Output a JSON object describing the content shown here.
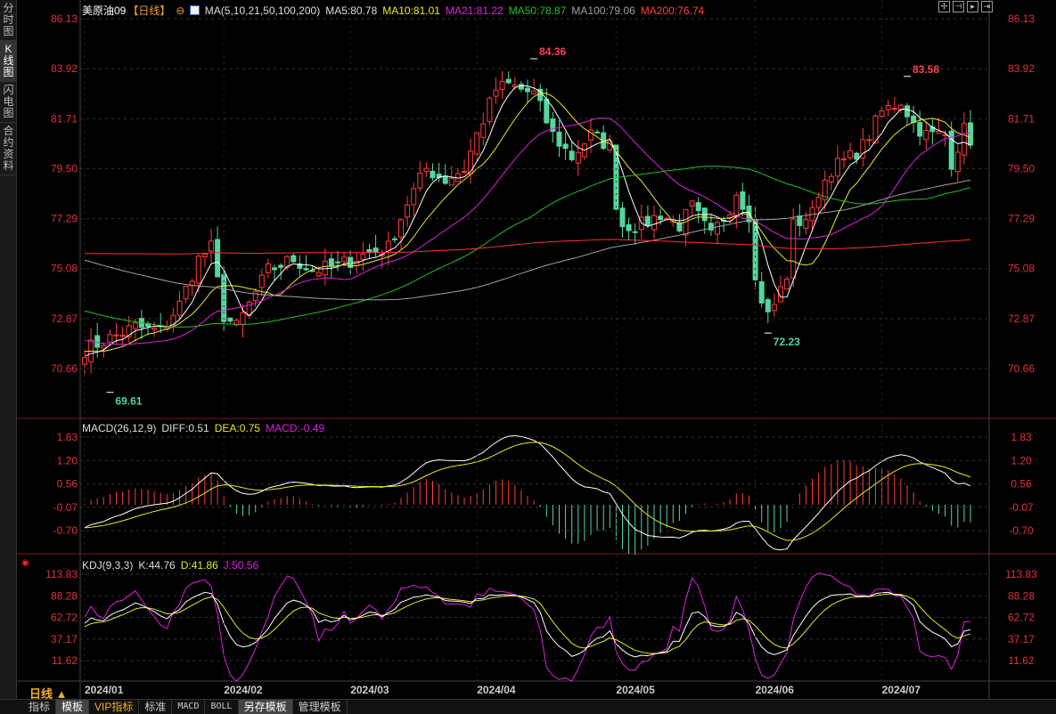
{
  "sidebar": {
    "tabs": [
      {
        "label": "分时图"
      },
      {
        "label": "K线图"
      },
      {
        "label": "闪电图"
      },
      {
        "label": "合约资料"
      }
    ]
  },
  "header": {
    "symbol": "美原油09",
    "period": "【日线】",
    "ma_label": "MA(5,10,21,50,100,200)",
    "ma5": "MA5:80.78",
    "ma10": "MA10:81.01",
    "ma21": "MA21:81.22",
    "ma50": "MA50:78.87",
    "ma100": "MA100:79.06",
    "ma200": "MA200:76.74"
  },
  "macd_legend": {
    "name": "MACD(26,12,9)",
    "diff": "DIFF:0.51",
    "dea": "DEA:0.75",
    "macd": "MACD:-0.49"
  },
  "kdj_legend": {
    "name": "KDJ(9,3,3)",
    "k": "K:44.76",
    "d": "D:41.86",
    "j": "J:50.56"
  },
  "period_label": "日线 ▲",
  "bottom_tabs": [
    {
      "label": "指标"
    },
    {
      "label": "模板"
    },
    {
      "label": "VIP指标"
    },
    {
      "label": "标准"
    },
    {
      "label": "MACD"
    },
    {
      "label": "BOLL"
    },
    {
      "label": "另存模板"
    },
    {
      "label": "管理模板"
    }
  ],
  "colors": {
    "up": "#ff3b3b",
    "down": "#54d6a0",
    "ma5": "#ffffff",
    "ma10": "#e8e820",
    "ma21": "#e020e0",
    "ma50": "#20c020",
    "ma100": "#a0a0a0",
    "ma200": "#ff3030"
  },
  "chart_data": {
    "type": "candlestick",
    "price_ticks": [
      "86.13",
      "83.92",
      "81.71",
      "79.50",
      "77.29",
      "75.08",
      "72.87",
      "70.66"
    ],
    "macd_ticks": [
      "1.83",
      "1.20",
      "0.56",
      "-0.07",
      "-0.70"
    ],
    "kdj_ticks": [
      "113.83",
      "88.28",
      "62.72",
      "37.17",
      "11.62"
    ],
    "x_labels": [
      "2024/01",
      "2024/02",
      "2024/03",
      "2024/04",
      "2024/05",
      "2024/06",
      "2024/07"
    ],
    "x_label_day_index": [
      0,
      22,
      42,
      62,
      84,
      106,
      126
    ],
    "annotations": [
      {
        "label": "69.61",
        "value": 69.61,
        "day": 4
      },
      {
        "label": "84.36",
        "value": 84.36,
        "day": 71
      },
      {
        "label": "72.23",
        "value": 72.23,
        "day": 108
      },
      {
        "label": "83.58",
        "value": 83.58,
        "day": 130
      }
    ],
    "close_keypoints": [
      [
        0,
        71.5
      ],
      [
        4,
        72
      ],
      [
        8,
        72.5
      ],
      [
        12,
        72.3
      ],
      [
        15,
        73.5
      ],
      [
        18,
        75.5
      ],
      [
        20,
        76
      ],
      [
        22,
        73
      ],
      [
        24,
        72.5
      ],
      [
        26,
        73.5
      ],
      [
        29,
        75
      ],
      [
        33,
        75.5
      ],
      [
        36,
        75
      ],
      [
        40,
        75.2
      ],
      [
        45,
        75.8
      ],
      [
        48,
        76
      ],
      [
        51,
        78
      ],
      [
        54,
        79.5
      ],
      [
        57,
        79
      ],
      [
        60,
        79.5
      ],
      [
        62,
        81
      ],
      [
        65,
        83
      ],
      [
        67,
        83.2
      ],
      [
        71,
        82.8
      ],
      [
        74,
        81
      ],
      [
        77,
        80
      ],
      [
        80,
        81
      ],
      [
        83,
        80.5
      ],
      [
        84,
        78
      ],
      [
        85,
        77
      ],
      [
        88,
        77
      ],
      [
        91,
        77.5
      ],
      [
        94,
        77
      ],
      [
        96,
        77.8
      ],
      [
        99,
        76.5
      ],
      [
        102,
        77.8
      ],
      [
        103,
        78.5
      ],
      [
        105,
        77.5
      ],
      [
        106,
        74.5
      ],
      [
        108,
        73
      ],
      [
        109,
        73.5
      ],
      [
        111,
        74.8
      ],
      [
        112,
        77
      ],
      [
        115,
        77.5
      ],
      [
        116,
        78.5
      ],
      [
        118,
        79.5
      ],
      [
        121,
        80
      ],
      [
        123,
        80.5
      ],
      [
        126,
        82
      ],
      [
        129,
        82.5
      ],
      [
        131,
        81.5
      ],
      [
        133,
        81
      ],
      [
        136,
        81
      ],
      [
        137,
        79.8
      ],
      [
        139,
        81.2
      ],
      [
        140,
        80.8
      ]
    ]
  }
}
